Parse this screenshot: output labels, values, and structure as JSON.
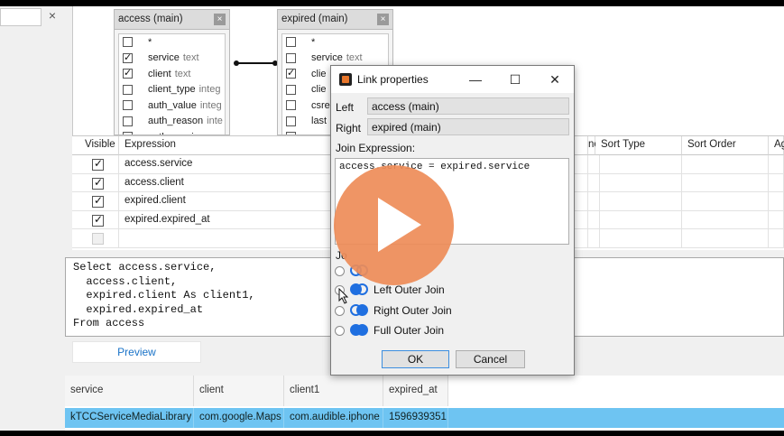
{
  "top_left": {
    "close_glyph": "×"
  },
  "tables": [
    {
      "title": "access (main)",
      "close_glyph": "×",
      "fields": [
        {
          "name": "*",
          "type": "",
          "checked": false
        },
        {
          "name": "service",
          "type": "text",
          "checked": true
        },
        {
          "name": "client",
          "type": "text",
          "checked": true
        },
        {
          "name": "client_type",
          "type": "integ",
          "checked": false
        },
        {
          "name": "auth_value",
          "type": "integ",
          "checked": false
        },
        {
          "name": "auth_reason",
          "type": "inte",
          "checked": false
        },
        {
          "name": "auth_version",
          "type": "",
          "checked": false
        }
      ]
    },
    {
      "title": "expired (main)",
      "close_glyph": "×",
      "fields": [
        {
          "name": "*",
          "type": "",
          "checked": false
        },
        {
          "name": "service",
          "type": "text",
          "checked": false
        },
        {
          "name": "clie",
          "type": "",
          "checked": true
        },
        {
          "name": "clie",
          "type": "",
          "checked": false
        },
        {
          "name": "csre",
          "type": "",
          "checked": false
        },
        {
          "name": "last",
          "type": "",
          "checked": false
        },
        {
          "name": "",
          "type": "",
          "checked": false
        }
      ]
    }
  ],
  "grid": {
    "headers": [
      "Visible",
      "Expression",
      "ne",
      "Sort Type",
      "Sort Order",
      "Ag"
    ],
    "rows": [
      {
        "visible": true,
        "expression": "access.service"
      },
      {
        "visible": true,
        "expression": "access.client"
      },
      {
        "visible": true,
        "expression": "expired.client"
      },
      {
        "visible": true,
        "expression": "expired.expired_at"
      },
      {
        "visible": false,
        "expression": ""
      }
    ]
  },
  "sql_text": "Select access.service,\n  access.client,\n  expired.client As client1,\n  expired.expired_at\nFrom access",
  "preview_label": "Preview",
  "results": {
    "headers": [
      "service",
      "client",
      "client1",
      "expired_at"
    ],
    "row": [
      "kTCCServiceMediaLibrary",
      "com.google.Maps",
      "com.audible.iphone",
      "1596939351"
    ]
  },
  "dialog": {
    "title": "Link properties",
    "minimize_glyph": "—",
    "maximize_glyph": "☐",
    "close_glyph": "✕",
    "left_label": "Left",
    "left_value": "access (main)",
    "right_label": "Right",
    "right_value": "expired (main)",
    "join_expression_label": "Join Expression:",
    "join_expression": "access.service = expired.service",
    "join_type_label": "Jo",
    "join_types": [
      {
        "label": "",
        "selected": false
      },
      {
        "label": "Left Outer Join",
        "selected": false
      },
      {
        "label": "Right Outer Join",
        "selected": false
      },
      {
        "label": "Full Outer Join",
        "selected": false
      }
    ],
    "ok_label": "OK",
    "cancel_label": "Cancel"
  },
  "colors": {
    "results_highlight": "#6ec4f2",
    "play_overlay": "#ee8c58",
    "venn": "#1f6fe0",
    "preview_link": "#1a73c8"
  }
}
